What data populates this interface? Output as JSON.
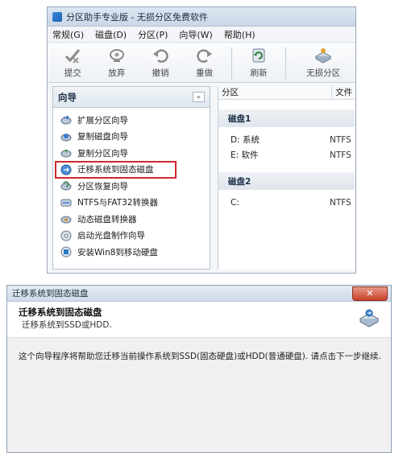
{
  "app": {
    "title": "分区助手专业版 - 无损分区免费软件",
    "menu": [
      "常规(G)",
      "磁盘(D)",
      "分区(P)",
      "向导(W)",
      "帮助(H)"
    ],
    "toolbar": {
      "submit": {
        "label": "提交",
        "icon": "check-arrow-icon"
      },
      "discard": {
        "label": "放弃",
        "icon": "discard-icon"
      },
      "undo": {
        "label": "撤销",
        "icon": "undo-icon"
      },
      "redo": {
        "label": "重做",
        "icon": "redo-icon"
      },
      "refresh": {
        "label": "刷新",
        "icon": "refresh-icon"
      },
      "lossless": {
        "label": "无损分区",
        "icon": "lossless-partition-icon"
      }
    },
    "wizard_panel": {
      "title": "向导",
      "collapse_symbol": "«",
      "items": [
        {
          "label": "扩展分区向导",
          "icon": "extend-partition-icon"
        },
        {
          "label": "复制磁盘向导",
          "icon": "copy-disk-icon"
        },
        {
          "label": "复制分区向导",
          "icon": "copy-partition-icon"
        },
        {
          "label": "迁移系统到固态磁盘",
          "icon": "migrate-os-icon",
          "highlighted": true
        },
        {
          "label": "分区恢复向导",
          "icon": "partition-recovery-icon"
        },
        {
          "label": "NTFS与FAT32转换器",
          "icon": "converter-icon"
        },
        {
          "label": "动态磁盘转换器",
          "icon": "dynamic-disk-icon"
        },
        {
          "label": "启动光盘制作向导",
          "icon": "boot-disc-icon"
        },
        {
          "label": "安装Win8到移动硬盘",
          "icon": "install-win8-icon"
        }
      ]
    },
    "grid": {
      "headers": [
        "分区",
        "文件"
      ],
      "disks": [
        {
          "name": "磁盘1",
          "partitions": [
            {
              "name": "D: 系统",
              "fs": "NTFS"
            },
            {
              "name": "E: 软件",
              "fs": "NTFS"
            }
          ]
        },
        {
          "name": "磁盘2",
          "partitions": [
            {
              "name": "C:",
              "fs": "NTFS"
            }
          ]
        }
      ]
    }
  },
  "dialog": {
    "window_title": "迁移系统到固态磁盘",
    "close_symbol": "✕",
    "heading": "迁移系统到固态磁盘",
    "subheading": "迁移系统到SSD或HDD.",
    "body": "这个向导程序将帮助您迁移当前操作系统到SSD(固态硬盘)或HDD(普通硬盘). 请点击下一步继续.",
    "icon": "migrate-os-icon"
  },
  "colors": {
    "highlight_border": "#d0282d",
    "title_bar": "#cfdbe9",
    "close_button": "#c7402a"
  }
}
